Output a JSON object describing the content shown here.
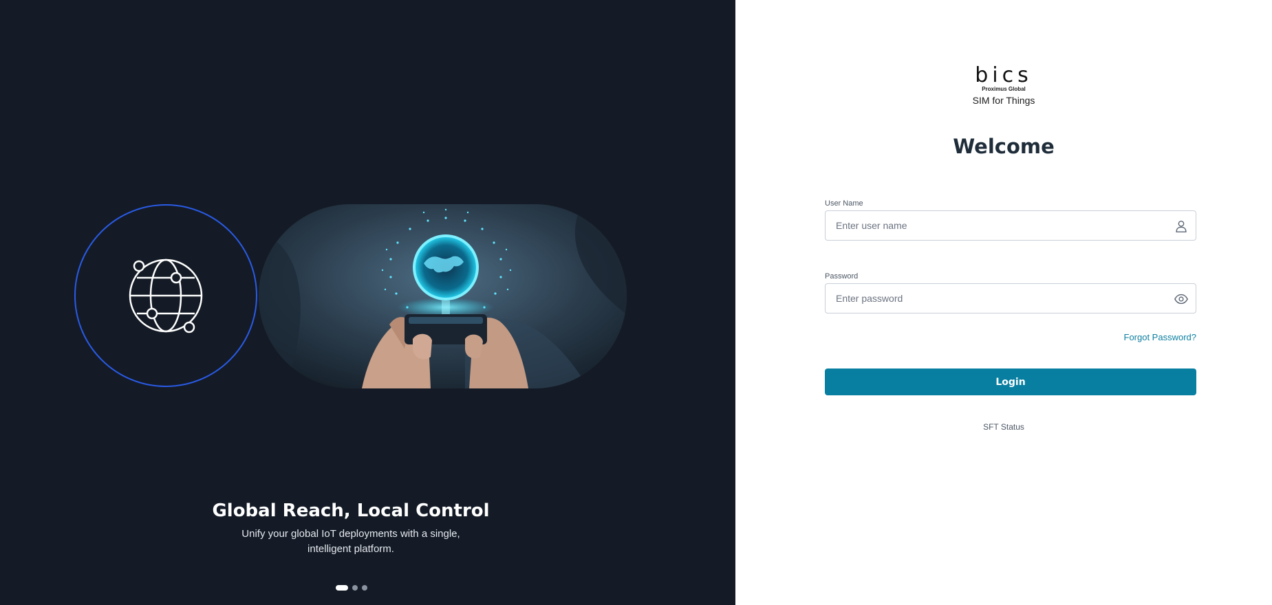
{
  "hero": {
    "title": "Global Reach, Local Control",
    "subtitle": "Unify your global IoT deployments with a single, intelligent platform.",
    "carousel": {
      "slide_count": 3,
      "active_index": 0
    },
    "icons": {
      "globe": "globe-network-icon",
      "image": "hand-holding-phone-hologram-globe"
    },
    "colors": {
      "background": "#141b26",
      "circle_border": "#2a5be8",
      "hologram": "#26d4f2"
    }
  },
  "brand": {
    "logo_text": "bics",
    "logo_subtext": "Proximus Global",
    "product": "SIM for Things"
  },
  "login": {
    "heading": "Welcome",
    "username": {
      "label": "User Name",
      "placeholder": "Enter user name",
      "value": "",
      "icon": "user-icon"
    },
    "password": {
      "label": "Password",
      "placeholder": "Enter password",
      "value": "",
      "icon": "eye-icon"
    },
    "forgot_label": "Forgot Password?",
    "submit_label": "Login",
    "status_label": "SFT Status",
    "colors": {
      "primary": "#087fa1",
      "link": "#0c7fa0",
      "heading": "#1f2d3a"
    }
  }
}
